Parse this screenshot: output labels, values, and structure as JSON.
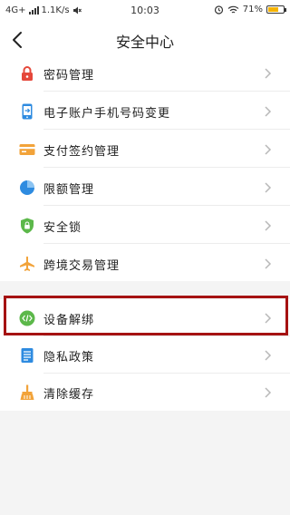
{
  "status_bar": {
    "network": "4G+",
    "speed": "1.1K/s",
    "time": "10:03",
    "battery_percent": "71%",
    "battery_level": 0.71,
    "battery_color": "#f5b300"
  },
  "nav": {
    "back_icon": "chevron-left-icon",
    "title": "安全中心"
  },
  "group_main": {
    "items": [
      {
        "label": "密码管理",
        "icon": "lock-icon",
        "color": "#e5473a"
      },
      {
        "label": "电子账户手机号码变更",
        "icon": "phone-icon",
        "color": "#2e8be0"
      },
      {
        "label": "支付签约管理",
        "icon": "card-icon",
        "color": "#f2a33a"
      },
      {
        "label": "限额管理",
        "icon": "pie-chart-icon",
        "color": "#2e8be0"
      },
      {
        "label": "安全锁",
        "icon": "shield-lock-icon",
        "color": "#5cb84a"
      },
      {
        "label": "跨境交易管理",
        "icon": "airplane-icon",
        "color": "#f2a33a"
      }
    ]
  },
  "group_other": {
    "items": [
      {
        "label": "设备解绑",
        "icon": "unbind-device-icon",
        "color": "#5cb84a"
      },
      {
        "label": "隐私政策",
        "icon": "document-icon",
        "color": "#2e8be0"
      },
      {
        "label": "清除缓存",
        "icon": "broom-icon",
        "color": "#f2a33a"
      }
    ]
  },
  "highlight_color": "#a51212"
}
